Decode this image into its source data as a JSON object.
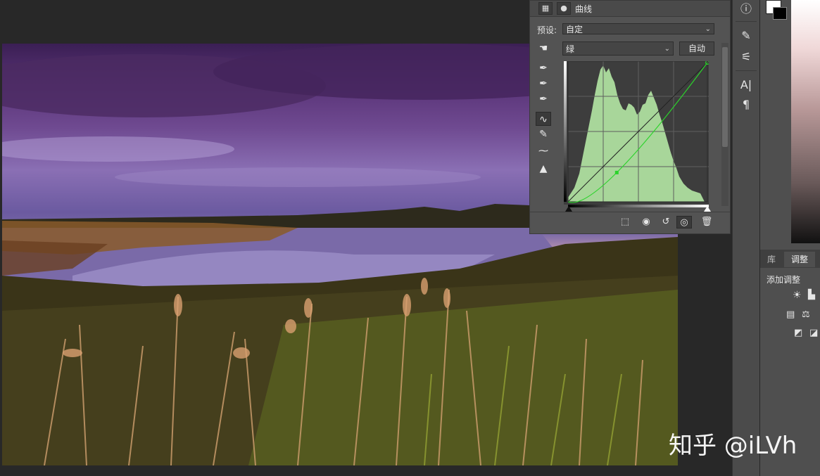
{
  "properties_panel": {
    "title": "曲线",
    "preset_label": "预设:",
    "preset_value": "自定",
    "channel_value": "绿",
    "auto_button": "自动",
    "tools": [
      "hand-target-icon",
      "eyedropper-black-icon",
      "eyedropper-gray-icon",
      "eyedropper-white-icon",
      "curve-points-icon",
      "pencil-icon",
      "smooth-icon",
      "histogram-warning-icon"
    ],
    "histogram_color": "#a8d69a",
    "curve_color": "#2bd32b",
    "curve_points": [
      [
        0,
        0
      ],
      [
        0.35,
        0.21
      ],
      [
        1,
        1
      ]
    ],
    "bottom_icons": [
      "clip-to-layer-icon",
      "view-previous-icon",
      "reset-icon",
      "visibility-eye-icon",
      "delete-trash-icon"
    ]
  },
  "right_strip": {
    "icons": [
      "info-icon",
      "brush-settings-icon",
      "adjustments-icon",
      "character-icon",
      "paragraph-icon"
    ],
    "glyphs": [
      "ⓘ",
      "✎",
      "⚟",
      "A|",
      "¶"
    ]
  },
  "side_panel": {
    "tabs": [
      "库",
      "调整"
    ],
    "add_adjustment_label": "添加调整"
  },
  "watermark": "知乎 @iLVh"
}
